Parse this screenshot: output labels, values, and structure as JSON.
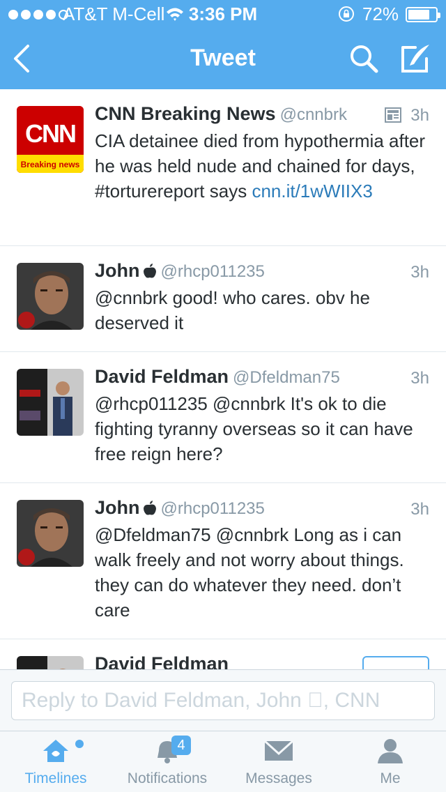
{
  "status_bar": {
    "carrier": "AT&T M-Cell",
    "time": "3:36 PM",
    "battery": "72%"
  },
  "nav": {
    "title": "Tweet",
    "back_icon": "chevron-left-icon",
    "search_icon": "search-icon",
    "compose_icon": "compose-icon"
  },
  "tweets": [
    {
      "name": "CNN Breaking News",
      "handle": "@cnnbrk",
      "time": "3h",
      "text": "CIA detainee died from hypothermia after he was held nude and chained for days, #torturereport says ",
      "link": "cnn.it/​1wWIIX3",
      "avatar_text": "CNN",
      "avatar_subtext": "Breaking news"
    },
    {
      "name": "John",
      "handle": "@rhcp011235",
      "time": "3h",
      "text": "@cnnbrk good! who cares. obv he deserved it"
    },
    {
      "name": "David Feldman",
      "handle": "@Dfeldman75",
      "time": "3h",
      "text": "@rhcp011235 @cnnbrk It's ok to die fighting tyranny overseas so it can have free reign here?"
    },
    {
      "name": "John",
      "handle": "@rhcp011235",
      "time": "3h",
      "text": "@Dfeldman75 @cnnbrk Long as i can walk freely and not worry about things. they can do whatever they need. don’t care"
    },
    {
      "name": "David Feldman"
    }
  ],
  "reply": {
    "placeholder": "Reply to David Feldman, John , CNN"
  },
  "tabs": [
    {
      "label": "Timelines",
      "icon": "home-icon",
      "active": true
    },
    {
      "label": "Notifications",
      "icon": "bell-icon",
      "badge": "4"
    },
    {
      "label": "Messages",
      "icon": "envelope-icon"
    },
    {
      "label": "Me",
      "icon": "person-icon"
    }
  ],
  "colors": {
    "brand": "#55acee",
    "link": "#2b7bb9",
    "muted": "#8899a6"
  }
}
